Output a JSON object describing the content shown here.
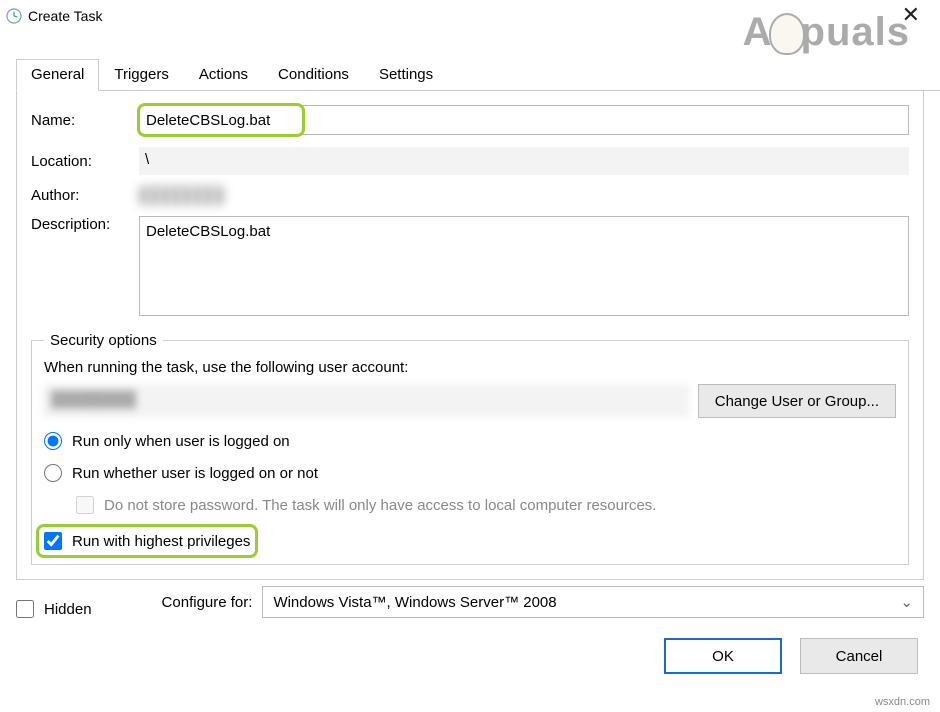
{
  "window": {
    "title": "Create Task",
    "watermark": "Appuals",
    "small_watermark": "wsxdn.com"
  },
  "tabs": [
    {
      "label": "General",
      "active": true
    },
    {
      "label": "Triggers",
      "active": false
    },
    {
      "label": "Actions",
      "active": false
    },
    {
      "label": "Conditions",
      "active": false
    },
    {
      "label": "Settings",
      "active": false
    }
  ],
  "general": {
    "name_label": "Name:",
    "name_value": "DeleteCBSLog.bat",
    "location_label": "Location:",
    "location_value": "\\",
    "author_label": "Author:",
    "author_value": "████████",
    "description_label": "Description:",
    "description_value": "DeleteCBSLog.bat"
  },
  "security": {
    "legend": "Security options",
    "prompt": "When running the task, use the following user account:",
    "account_value": "████████",
    "change_button": "Change User or Group...",
    "radio_logged_on": "Run only when user is logged on",
    "radio_whether": "Run whether user is logged on or not",
    "no_store_password": "Do not store password.  The task will only have access to local computer resources.",
    "run_highest": "Run with highest privileges",
    "selected_radio": "logged_on",
    "run_highest_checked": true,
    "store_password_checked": false
  },
  "bottom": {
    "hidden_label": "Hidden",
    "hidden_checked": false,
    "configure_label": "Configure for:",
    "configure_value": "Windows Vista™, Windows Server™ 2008"
  },
  "buttons": {
    "ok": "OK",
    "cancel": "Cancel"
  }
}
